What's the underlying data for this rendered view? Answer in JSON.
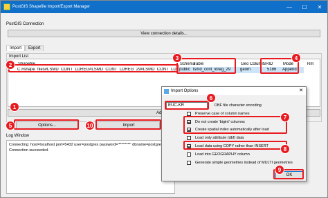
{
  "window": {
    "title": "PostGIS Shapefile Import/Export Manager",
    "minimize": "—",
    "maximize": "☐",
    "close": "✕"
  },
  "connection": {
    "group_label": "PostGIS Connection",
    "view_button": "View connection details..."
  },
  "tabs": [
    {
      "label": "Import"
    },
    {
      "label": "Export"
    }
  ],
  "import_list": {
    "group_label": "Import List",
    "columns": {
      "shapefile": "Shapefile",
      "schema": "Schema",
      "table": "Table",
      "geo_column": "Geo Column",
      "srid": "SRID",
      "mode": "Mode",
      "rm": "Rm"
    },
    "row": {
      "shapefile": "C:#shape_files#LSMD_CONT_LDREG#LSMD_CONT_LDREG_29#LSMD_CONT_LDREG_29_202311.shp",
      "schema": "public",
      "table": "lsmd_cont_ldreg_29",
      "geo_column": "geom",
      "srid": "5186",
      "mode": "Append"
    }
  },
  "buttons": {
    "add_file": "Add File",
    "options": "Options...",
    "import": "Import"
  },
  "log": {
    "group_label": "Log Window",
    "lines": [
      "Connecting:  host=localhost port=5432 user=postgres password='********' dbname=postgres client",
      "Connection succeeded."
    ]
  },
  "dialog": {
    "title": "Import Options",
    "close": "✕",
    "encoding_value": "EUC-KR",
    "encoding_label": "DBF file character encoding",
    "options": [
      {
        "label": "Preserve case of column names",
        "checked": false
      },
      {
        "label": "Do not create 'bigint' columns",
        "checked": true
      },
      {
        "label": "Create spatial index automatically after load",
        "checked": true
      },
      {
        "label": "Load only attribute (dbf) data",
        "checked": false
      },
      {
        "label": "Load data using COPY rather than INSERT",
        "checked": true
      },
      {
        "label": "Load into GEOGRAPHY column",
        "checked": false
      },
      {
        "label": "Generate simple geometries instead of MULTI geometries",
        "checked": false
      }
    ],
    "ok_button": "OK"
  },
  "badges": [
    "1",
    "2",
    "3",
    "4",
    "5",
    "6",
    "7",
    "8",
    "9",
    "10"
  ],
  "colors": {
    "highlight": "#e8191f",
    "titlebar": "#0f6fc9",
    "selection": "#cce4f7"
  }
}
